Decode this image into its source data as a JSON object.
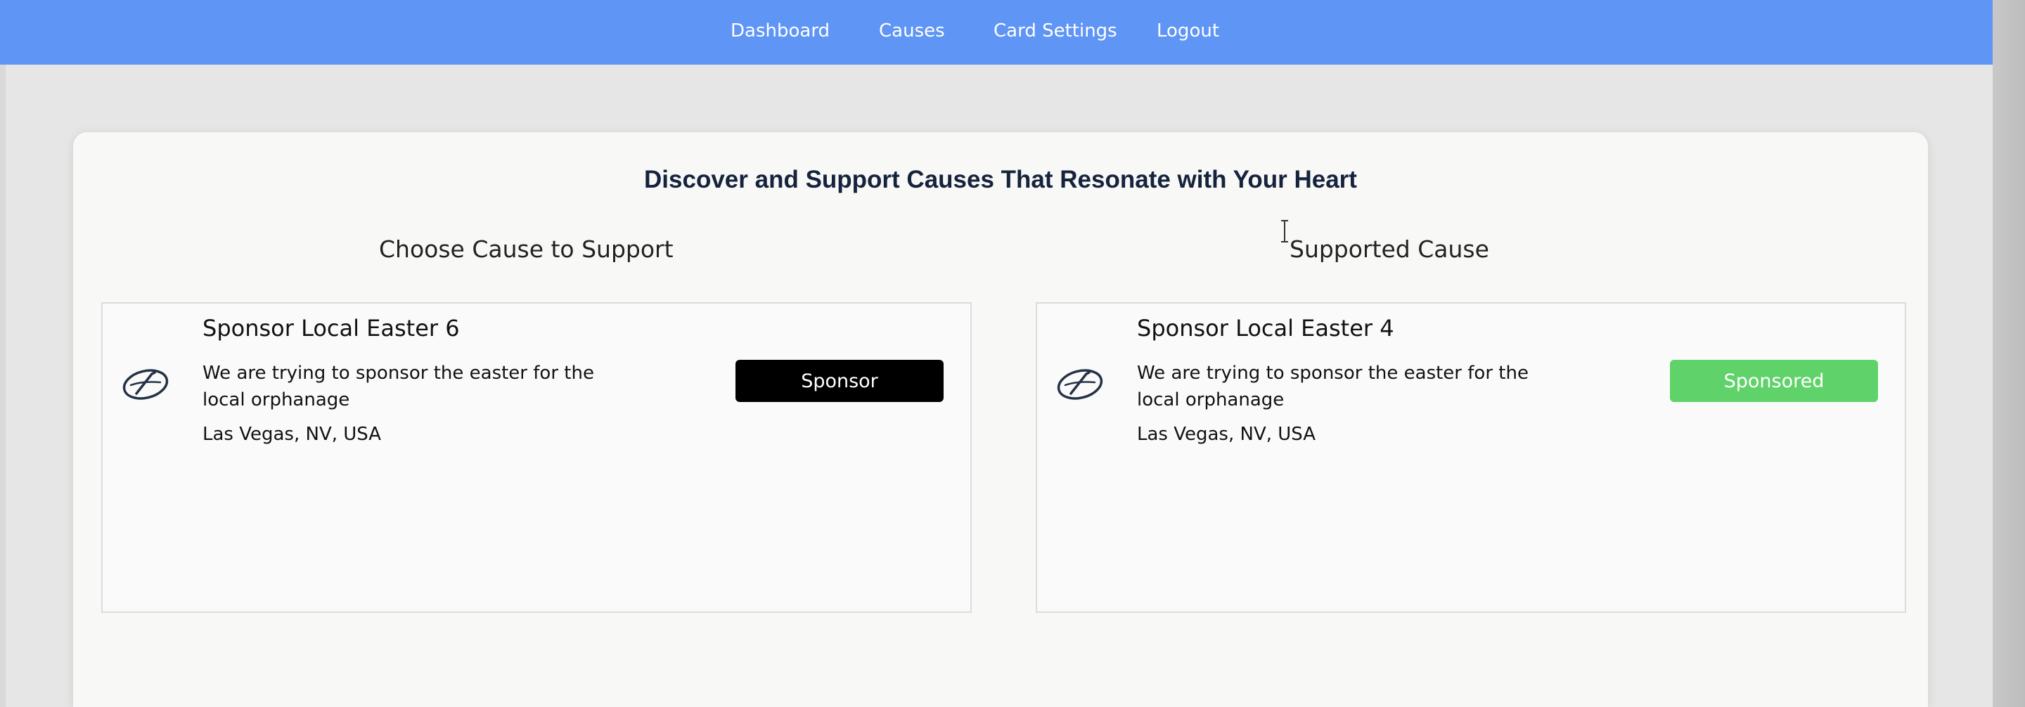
{
  "nav": {
    "items": [
      {
        "label": "Dashboard"
      },
      {
        "label": "Causes"
      },
      {
        "label": "Card Settings"
      },
      {
        "label": "Logout"
      }
    ],
    "background_color": "#5f95f5"
  },
  "page": {
    "heading": "Discover and Support Causes That Resonate with Your Heart"
  },
  "sections": {
    "choose": {
      "title": "Choose Cause to Support",
      "card": {
        "icon": "cause-logo-icon",
        "name": "Sponsor Local Easter 6",
        "description": "We are trying to sponsor the easter for the local orphanage",
        "location": "Las Vegas, NV, USA",
        "button_label": "Sponsor",
        "button_color": "#000000"
      }
    },
    "supported": {
      "title": "Supported Cause",
      "card": {
        "icon": "cause-logo-icon",
        "name": "Sponsor Local Easter 4",
        "description": "We are trying to sponsor the easter for the local orphanage",
        "location": "Las Vegas, NV, USA",
        "button_label": "Sponsored",
        "button_color": "#5fd36a"
      }
    }
  }
}
